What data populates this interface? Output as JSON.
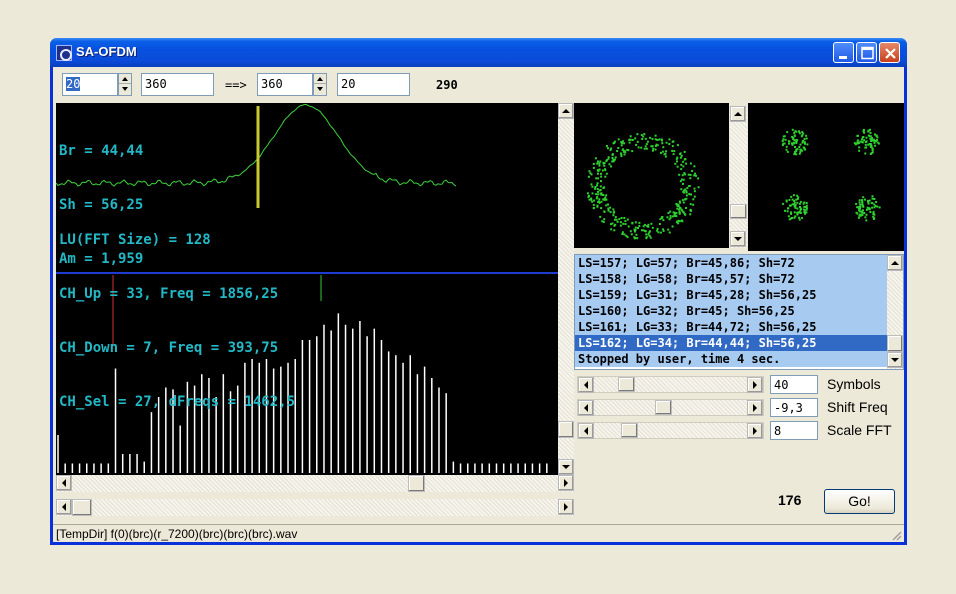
{
  "window": {
    "title": "SA-OFDM",
    "controls": [
      "minimize",
      "maximize",
      "close"
    ]
  },
  "toolbar": {
    "field1": "20",
    "field2": "360",
    "arrow": "==>",
    "field3": "360",
    "field4": "20",
    "value": "290"
  },
  "graph": {
    "top_lines": [
      "Br = 44,44",
      "Sh = 56,25",
      "Am = 1,959"
    ],
    "info_lines": [
      "LU(FFT Size) = 128",
      "CH_Up = 33, Freq = 1856,25",
      "CH_Down = 7, Freq = 393,75",
      "CH_Sel = 27, dFreqs = 1462,5"
    ],
    "colors": {
      "text": "#23b8c6",
      "curve": "#3cd23c",
      "marker": "#c8c832",
      "divider": "#1e3cd2"
    }
  },
  "spectrum": {
    "bar_heights": [
      0.2,
      0.05,
      0.05,
      0.05,
      0.05,
      0.05,
      0.05,
      0.05,
      0.55,
      0.1,
      0.1,
      0.1,
      0.06,
      0.32,
      0.4,
      0.45,
      0.44,
      0.25,
      0.48,
      0.46,
      0.52,
      0.5,
      0.4,
      0.52,
      0.43,
      0.46,
      0.58,
      0.6,
      0.58,
      0.6,
      0.55,
      0.56,
      0.58,
      0.6,
      0.7,
      0.7,
      0.72,
      0.78,
      0.75,
      0.84,
      0.78,
      0.76,
      0.8,
      0.72,
      0.76,
      0.7,
      0.64,
      0.62,
      0.58,
      0.62,
      0.52,
      0.56,
      0.5,
      0.45,
      0.42,
      0.06,
      0.05,
      0.05,
      0.05,
      0.05,
      0.05,
      0.05,
      0.05,
      0.05,
      0.05,
      0.05,
      0.05,
      0.05,
      0.05
    ],
    "red_marker": 0.2,
    "green_marker": 0.53
  },
  "log": {
    "rows": [
      "LS=157; LG=57; Br=45,86; Sh=72",
      "LS=158; LG=58; Br=45,57; Sh=72",
      "LS=159; LG=31; Br=45,28; Sh=56,25",
      "LS=160; LG=32; Br=45; Sh=56,25",
      "LS=161; LG=33; Br=44,72; Sh=56,25",
      "LS=162; LG=34; Br=44,44; Sh=56,25",
      "Stopped by user, time 4 sec."
    ],
    "selected_index": 5
  },
  "params": {
    "symbols": {
      "value": "40",
      "label": "Symbols",
      "slider": 0.18
    },
    "shift_freq": {
      "value": "-9,3",
      "label": "Shift Freq",
      "slider": 0.45
    },
    "scale_fft": {
      "value": "8",
      "label": "Scale FFT",
      "slider": 0.2
    }
  },
  "counter": "176",
  "go_label": "Go!",
  "status": "[TempDir] f(0)(brc)(r_7200)(brc)(brc)(brc).wav"
}
